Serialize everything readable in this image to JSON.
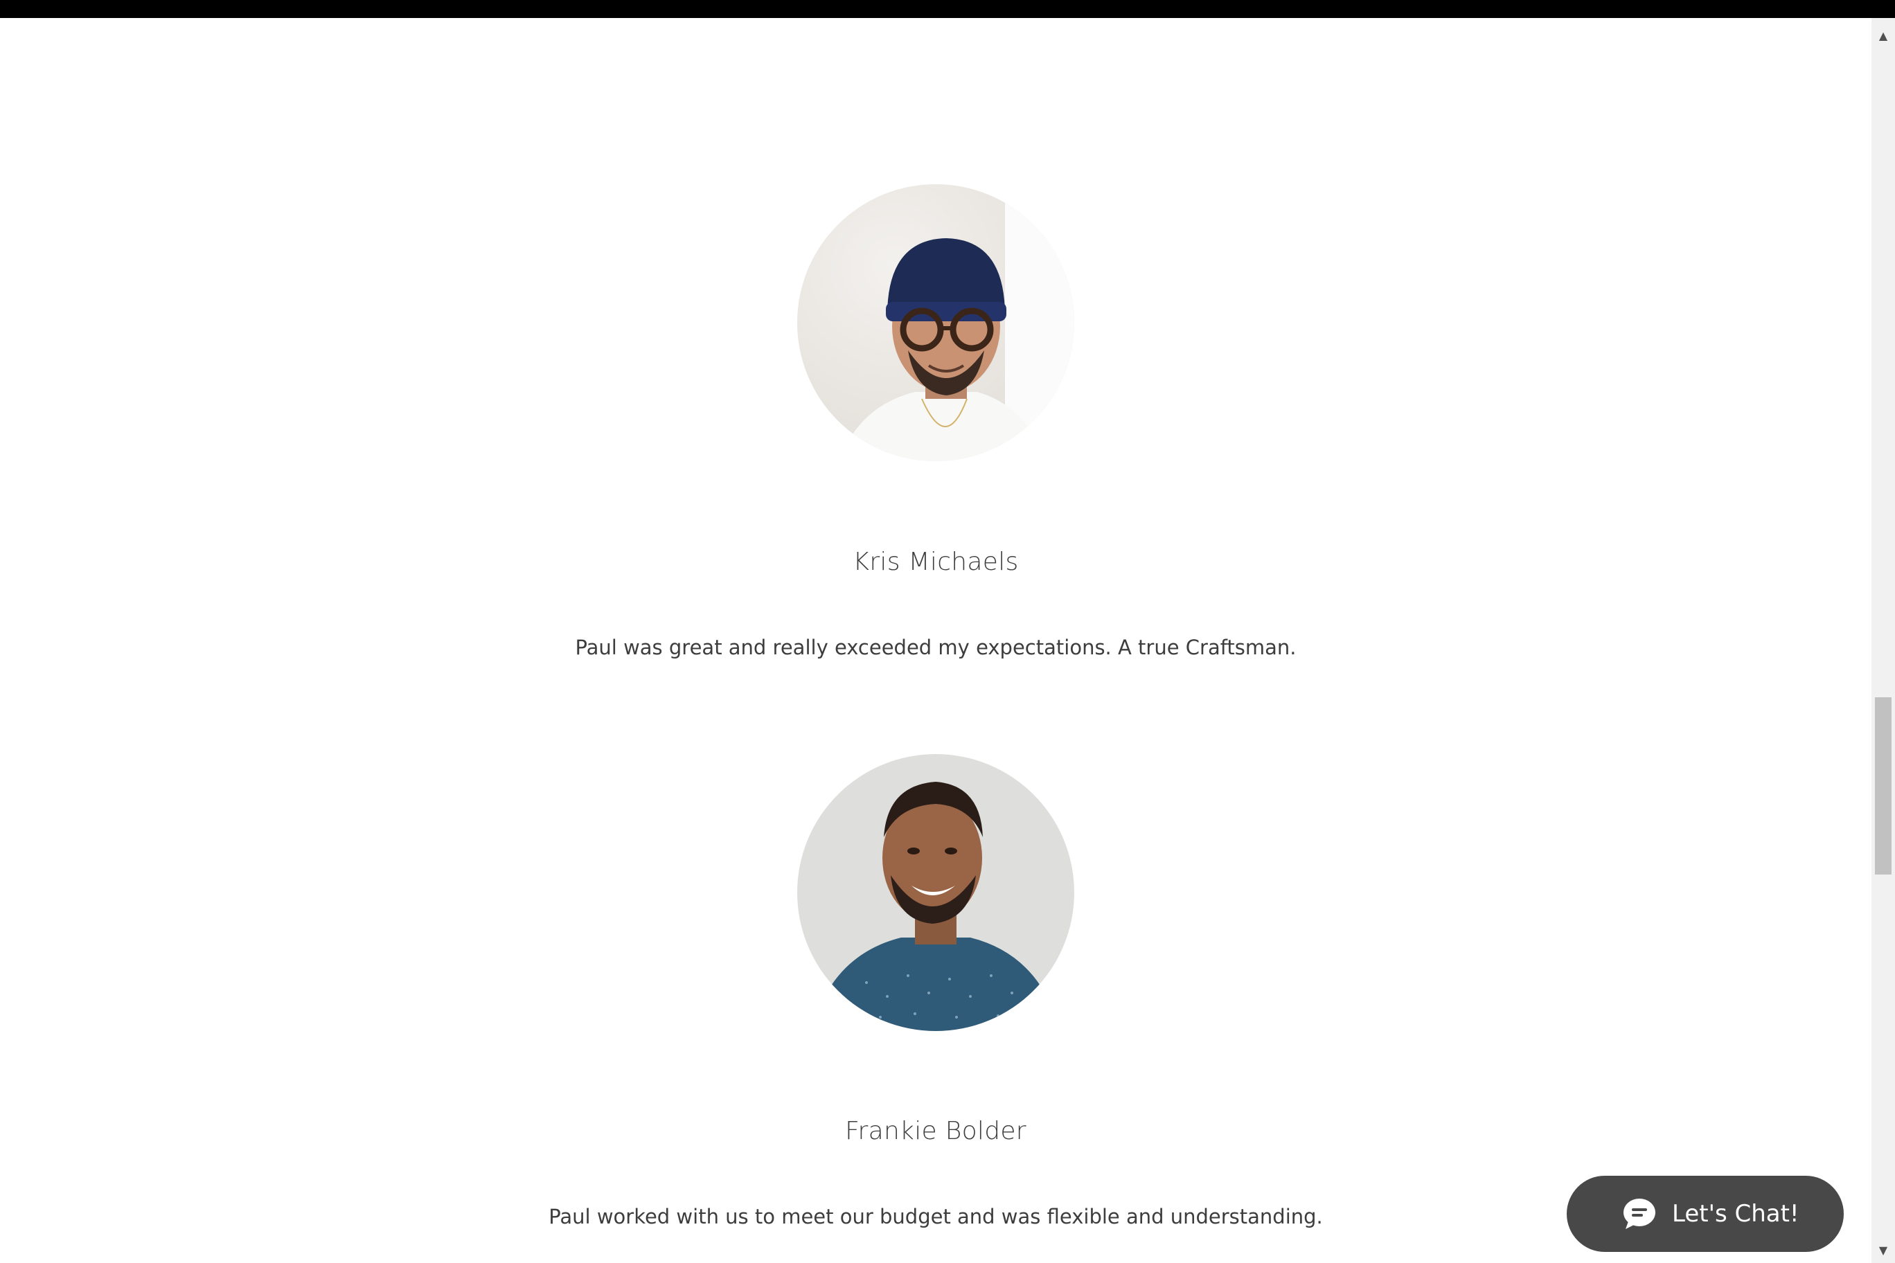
{
  "testimonials": [
    {
      "name": "Kris Michaels",
      "quote": "Paul was great and really exceeded my expectations. A true Craftsman.",
      "avatar_icon": "person-photo-beanie-glasses"
    },
    {
      "name": "Frankie Bolder",
      "quote": "Paul worked with us to meet our budget and was flexible and understanding.",
      "avatar_icon": "person-photo-smiling"
    }
  ],
  "chat": {
    "label": "Let's Chat!",
    "icon": "chat-bubble-icon",
    "color": "#484848"
  },
  "scrollbar": {
    "up_arrow": "▲",
    "down_arrow": "▼"
  }
}
